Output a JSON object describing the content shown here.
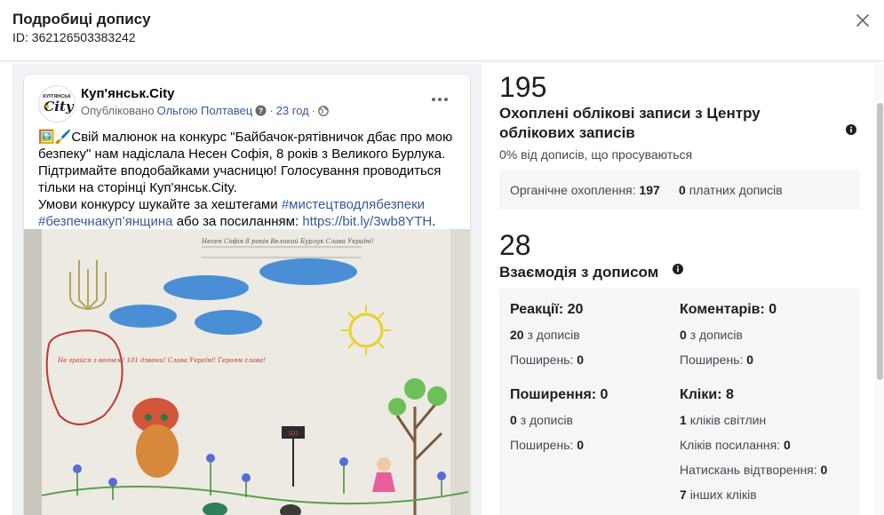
{
  "header": {
    "title": "Подробиці допису",
    "post_id": "ID: 362126503383242"
  },
  "post": {
    "avatar_text_top": "КУП'ЯНСЬК",
    "avatar_text_main": "City",
    "page_name": "Куп'янськ.City",
    "published_by_prefix": "Опубліковано",
    "author": "Ольгою Полтавец",
    "separator": "·",
    "time": "23 год",
    "emojis": "🖼️🖌️",
    "text_part1": "Свій малюнок на конкурс \"Байбачок-рятівничок дбає про мою безпеку\" нам надіслала Несен Софія, 8 років з Великого Бурлука. Підтримайте вподобайками учасницю! Голосування проводиться тільки на сторінці Куп'янськ.City.",
    "text_part2": "Умови конкурсу шукайте за хештегами",
    "hashtag1": "#мистецтводлябезпеки",
    "hashtag2": "#безпечнакуп’янщина",
    "text_or": "або за посиланням:",
    "url": "https://bit.ly/3wb8YTH",
    "url_end": ".",
    "drawing_caption": "Несен Софія 8 років Великий Бурлук Слава Україні!",
    "speech_bubble_text": "Не грайся з вогнем! 101 дзвони! Слава Україні! Героям слава!",
    "sign_text": "101"
  },
  "stats": {
    "reach_value": "195",
    "reach_title": "Охоплені облікові записи з Центру облікових записів",
    "reach_sub": "0% від дописів, що просуваються",
    "organic_label": "Органічне охоплення:",
    "organic_value": "197",
    "paid_value": "0",
    "paid_label": "платних дописів",
    "engagement_value": "28",
    "engagement_title": "Взаємодія з дописом",
    "reactions_title": "Реакції: 20",
    "reactions_from_value": "20",
    "reactions_from_label": "з дописів",
    "reactions_shares_label": "Поширень:",
    "reactions_shares_value": "0",
    "comments_title": "Коментарів: 0",
    "comments_from_value": "0",
    "comments_from_label": "з дописів",
    "comments_shares_label": "Поширень:",
    "comments_shares_value": "0",
    "shares_title": "Поширення: 0",
    "shares_from_value": "0",
    "shares_from_label": "з дописів",
    "shares_shares_label": "Поширень:",
    "shares_shares_value": "0",
    "clicks_title": "Кліки: 8",
    "photo_clicks_value": "1",
    "photo_clicks_label": "кліків світлин",
    "link_clicks_label": "Кліків посилання:",
    "link_clicks_value": "0",
    "play_clicks_label": "Натискань відтворення:",
    "play_clicks_value": "0",
    "other_clicks_value": "7",
    "other_clicks_label": "інших кліків"
  }
}
